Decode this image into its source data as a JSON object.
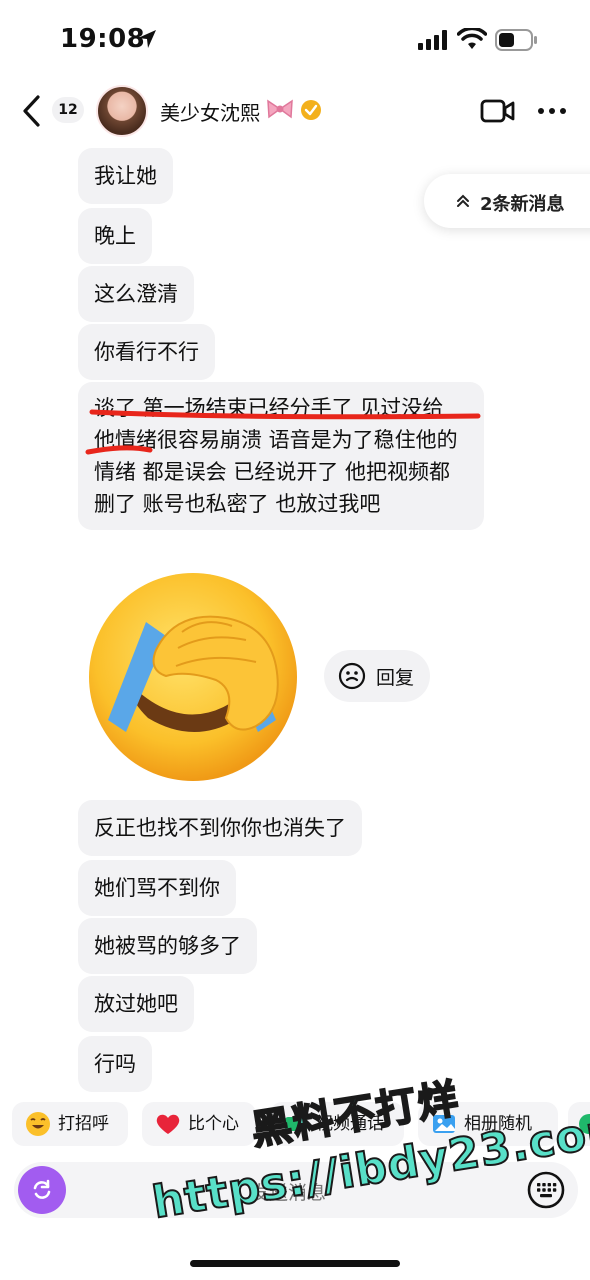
{
  "status_bar": {
    "time": "19:08"
  },
  "header": {
    "unread_count": "12",
    "contact_name": "美少女沈熙"
  },
  "new_messages": {
    "label": "2条新消息"
  },
  "messages": [
    "我让她",
    "晚上",
    "这么澄清",
    "你看行不行",
    "谈了 第一场结束已经分手了 见过没给 他情绪很容易崩溃 语音是为了稳住他的情绪 都是误会 已经说开了 他把视频都删了 账号也私密了 也放过我吧",
    "反正也找不到你你也消失了",
    "她们骂不到你",
    "她被骂的够多了",
    "放过她吧",
    "行吗"
  ],
  "sticker": {
    "emoji": "facepalm-crying-laughing-emoji"
  },
  "reply": {
    "label": "回复"
  },
  "quick_actions": [
    {
      "label": "打招呼",
      "icon": "grin-emoji-icon"
    },
    {
      "label": "比个心",
      "icon": "heart-icon"
    },
    {
      "label": "视频通话",
      "icon": "video-call-icon"
    },
    {
      "label": "相册随机",
      "icon": "album-icon"
    }
  ],
  "input": {
    "placeholder": "发送消息"
  },
  "watermark": {
    "line1": "黑料不打烊",
    "line2": "https://ibdy23.com"
  },
  "colors": {
    "accent_purple": "#a25cf0",
    "red_annotation": "#e8261b",
    "verified_gold": "#f3b01c",
    "bubble_gray": "#f2f2f4",
    "watermark_teal": "#58e0c8"
  }
}
